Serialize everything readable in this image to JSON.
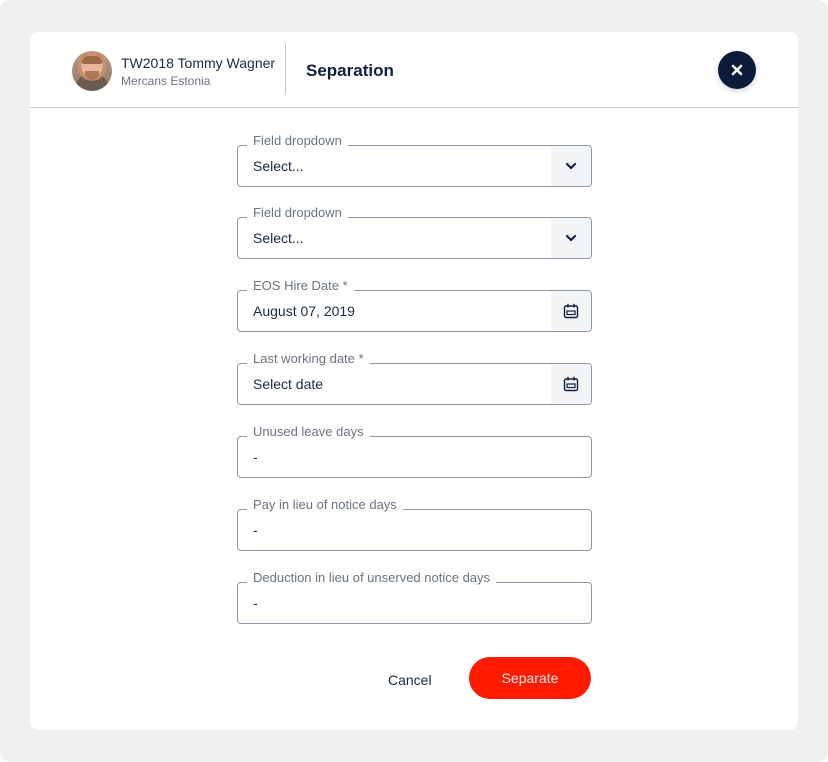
{
  "header": {
    "user_name": "TW2018 Tommy Wagner",
    "user_company": "Mercans Estonia",
    "title": "Separation",
    "close_icon": "close-icon"
  },
  "form": {
    "fields": [
      {
        "label": "Field dropdown",
        "value": "Select...",
        "type": "dropdown",
        "icon": "chevron-down-icon"
      },
      {
        "label": "Field dropdown",
        "value": "Select...",
        "type": "dropdown",
        "icon": "chevron-down-icon"
      },
      {
        "label": "EOS Hire Date *",
        "value": "August 07, 2019",
        "type": "date",
        "icon": "calendar-icon"
      },
      {
        "label": "Last working date *",
        "value": "Select date",
        "type": "date",
        "icon": "calendar-icon"
      },
      {
        "label": "Unused leave days",
        "value": "-",
        "type": "text"
      },
      {
        "label": "Pay in lieu of notice days",
        "value": "-",
        "type": "text"
      },
      {
        "label": "Deduction in lieu of unserved notice days",
        "value": "-",
        "type": "text"
      }
    ]
  },
  "actions": {
    "cancel_label": "Cancel",
    "separate_label": "Separate"
  },
  "colors": {
    "primary_action": "#ff1a00",
    "close_button": "#0d1b3a",
    "text_dark": "#0f1f3d"
  }
}
